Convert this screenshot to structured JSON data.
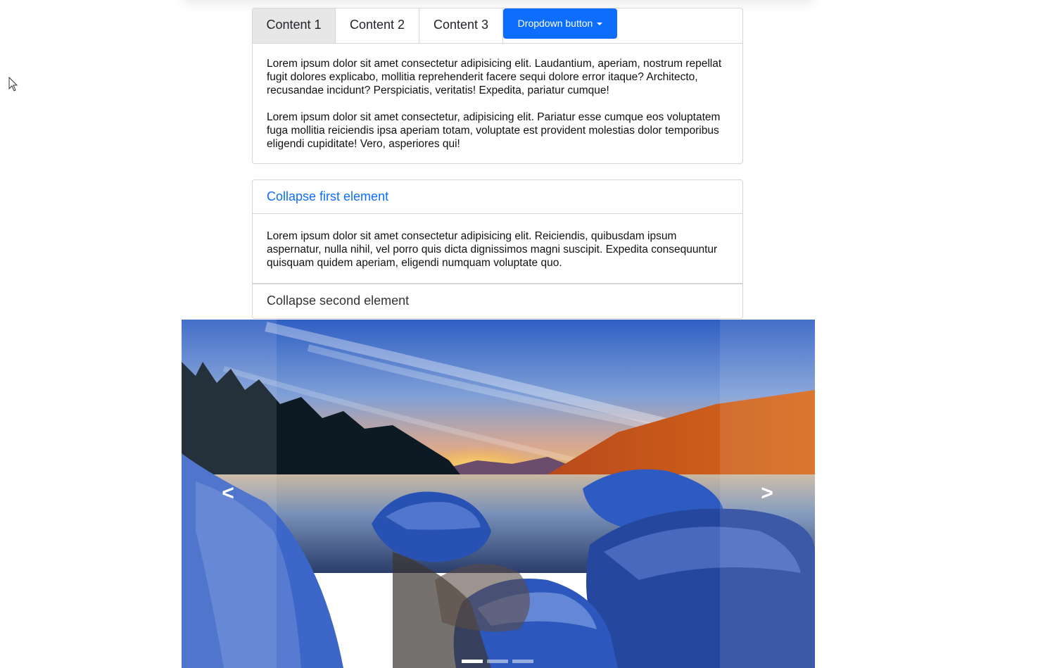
{
  "tabs": {
    "items": [
      {
        "label": "Content 1"
      },
      {
        "label": "Content 2"
      },
      {
        "label": "Content 3"
      }
    ],
    "active_index": 0,
    "dropdown_label": "Dropdown button",
    "content": [
      "Lorem ipsum dolor sit amet consectetur adipisicing elit. Laudantium, aperiam, nostrum repellat fugit dolores explicabo, mollitia reprehenderit facere sequi dolore error itaque? Architecto, recusandae incidunt? Perspiciatis, veritatis! Expedita, pariatur cumque!",
      "Lorem ipsum dolor sit amet consectetur, adipisicing elit. Pariatur esse cumque eos voluptatem fuga mollitia reiciendis ipsa aperiam totam, voluptate est provident molestias dolor temporibus eligendi cupiditate! Vero, asperiores qui!"
    ]
  },
  "accordion": {
    "items": [
      {
        "title": "Collapse first element",
        "expanded": true,
        "body": "Lorem ipsum dolor sit amet consectetur adipisicing elit. Reiciendis, quibusdam ipsum aspernatur, nulla nihil, vel porro quis dicta dignissimos magni suscipit. Expedita consequuntur quisquam quidem aperiam, eligendi numquam voluptate quo."
      },
      {
        "title": "Collapse second element",
        "expanded": false
      }
    ]
  },
  "carousel": {
    "prev_label": "<",
    "next_label": ">",
    "slide_count": 3,
    "active_slide": 0,
    "image_subject": "frosty lakeside rocks at sunset"
  },
  "colors": {
    "accent": "#0d6efd",
    "active_tab_bg": "#e7e7e7",
    "border": "#d6d6d6"
  }
}
